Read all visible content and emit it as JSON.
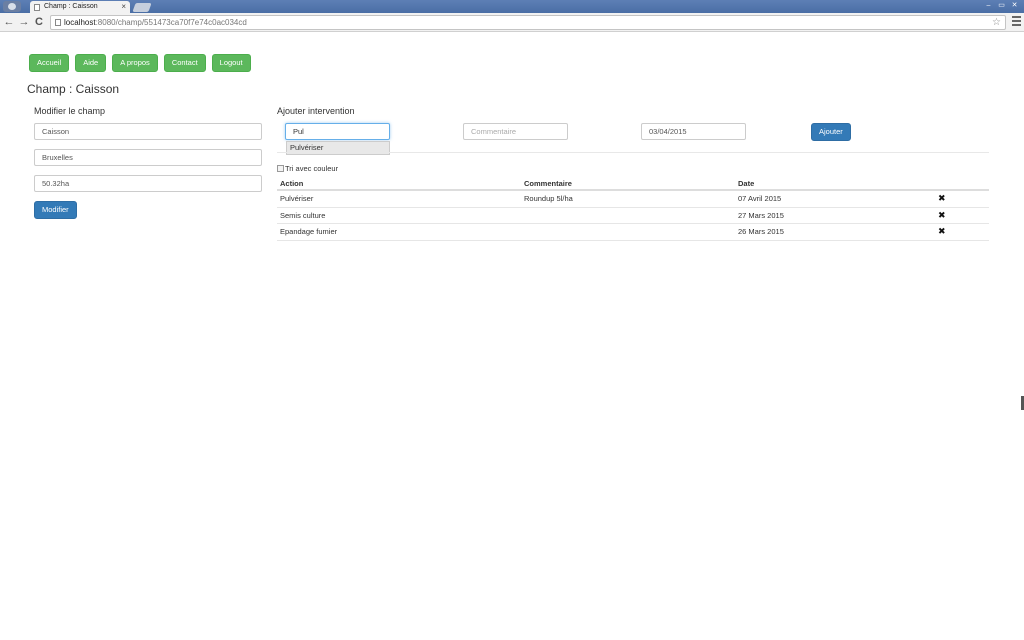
{
  "browser": {
    "tab_title": "Champ : Caisson",
    "tab_close": "×",
    "url_host": "localhost",
    "url_path": ":8080/champ/551473ca70f7e74c0ac034cd",
    "back_glyph": "←",
    "forward_glyph": "→",
    "reload_glyph": "C",
    "star_glyph": "☆",
    "win_minimize": "–",
    "win_maximize": "▭",
    "win_close": "✕"
  },
  "nav": {
    "accueil": "Accueil",
    "aide": "Aide",
    "apropos": "A propos",
    "contact": "Contact",
    "logout": "Logout"
  },
  "page": {
    "title": "Champ : Caisson"
  },
  "edit_form": {
    "title": "Modifier le champ",
    "name_value": "Caisson",
    "city_value": "Bruxelles",
    "area_value": "50.32ha",
    "submit_label": "Modifier"
  },
  "add_form": {
    "title": "Ajouter intervention",
    "action_value": "Pul",
    "comment_placeholder": "Commentaire",
    "date_value": "03/04/2015",
    "submit_label": "Ajouter",
    "suggestion": "Pulvériser"
  },
  "options": {
    "sort_color_label": "Tri avec couleur"
  },
  "table": {
    "headers": {
      "action": "Action",
      "comment": "Commentaire",
      "date": "Date"
    },
    "delete_glyph": "✖",
    "rows": [
      {
        "action": "Pulvériser",
        "comment": "Roundup 5l/ha",
        "date": "07 Avril 2015"
      },
      {
        "action": "Semis culture",
        "comment": "",
        "date": "27 Mars 2015"
      },
      {
        "action": "Epandage fumier",
        "comment": "",
        "date": "26 Mars 2015"
      }
    ]
  },
  "colors": {
    "nav_green": "#5cb85c",
    "primary_blue": "#337ab7",
    "titlebar_blue": "#5d7fb5"
  }
}
